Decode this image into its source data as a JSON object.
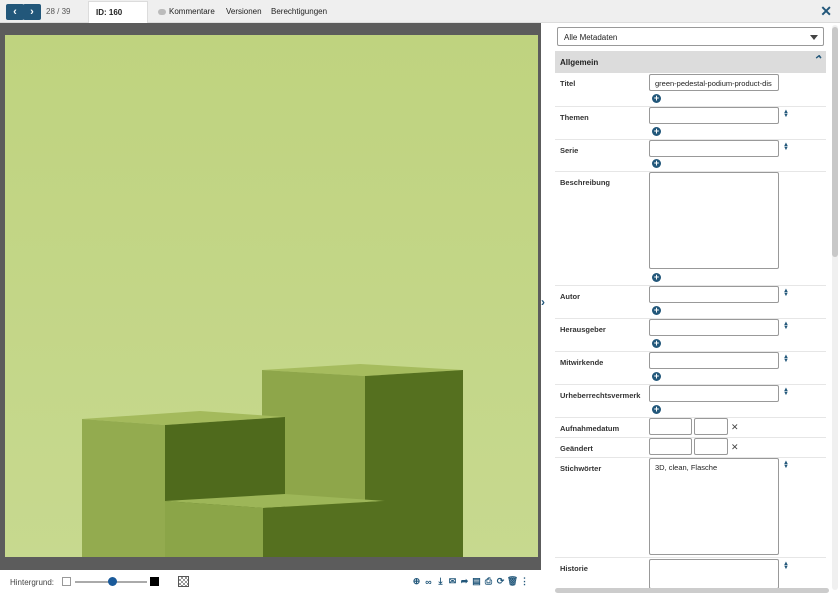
{
  "topbar": {
    "counter": "28 / 39",
    "active_tab": "ID: 160",
    "tabs": [
      "Kommentare",
      "Versionen",
      "Berechtigungen"
    ]
  },
  "viewer": {
    "background_label": "Hintergrund:"
  },
  "metadata": {
    "view_select": "Alle Metadaten",
    "section": "Allgemein",
    "fields": {
      "titel": {
        "label": "Titel",
        "value": "green-pedestal-podium-product-dis"
      },
      "themen": {
        "label": "Themen",
        "value": ""
      },
      "serie": {
        "label": "Serie",
        "value": ""
      },
      "beschreibung": {
        "label": "Beschreibung",
        "value": ""
      },
      "autor": {
        "label": "Autor",
        "value": ""
      },
      "herausgeber": {
        "label": "Herausgeber",
        "value": ""
      },
      "mitwirkende": {
        "label": "Mitwirkende",
        "value": ""
      },
      "urheber": {
        "label": "Urheberrechtsvermerk",
        "value": ""
      },
      "aufnahmedatum": {
        "label": "Aufnahmedatum"
      },
      "geaendert": {
        "label": "Geändert"
      },
      "stichwoerter": {
        "label": "Stichwörter",
        "value": "3D, clean, Flasche"
      },
      "historie": {
        "label": "Historie",
        "value": ""
      }
    }
  },
  "colors": {
    "accent": "#22577a",
    "image_bg": "#c4d48a"
  }
}
